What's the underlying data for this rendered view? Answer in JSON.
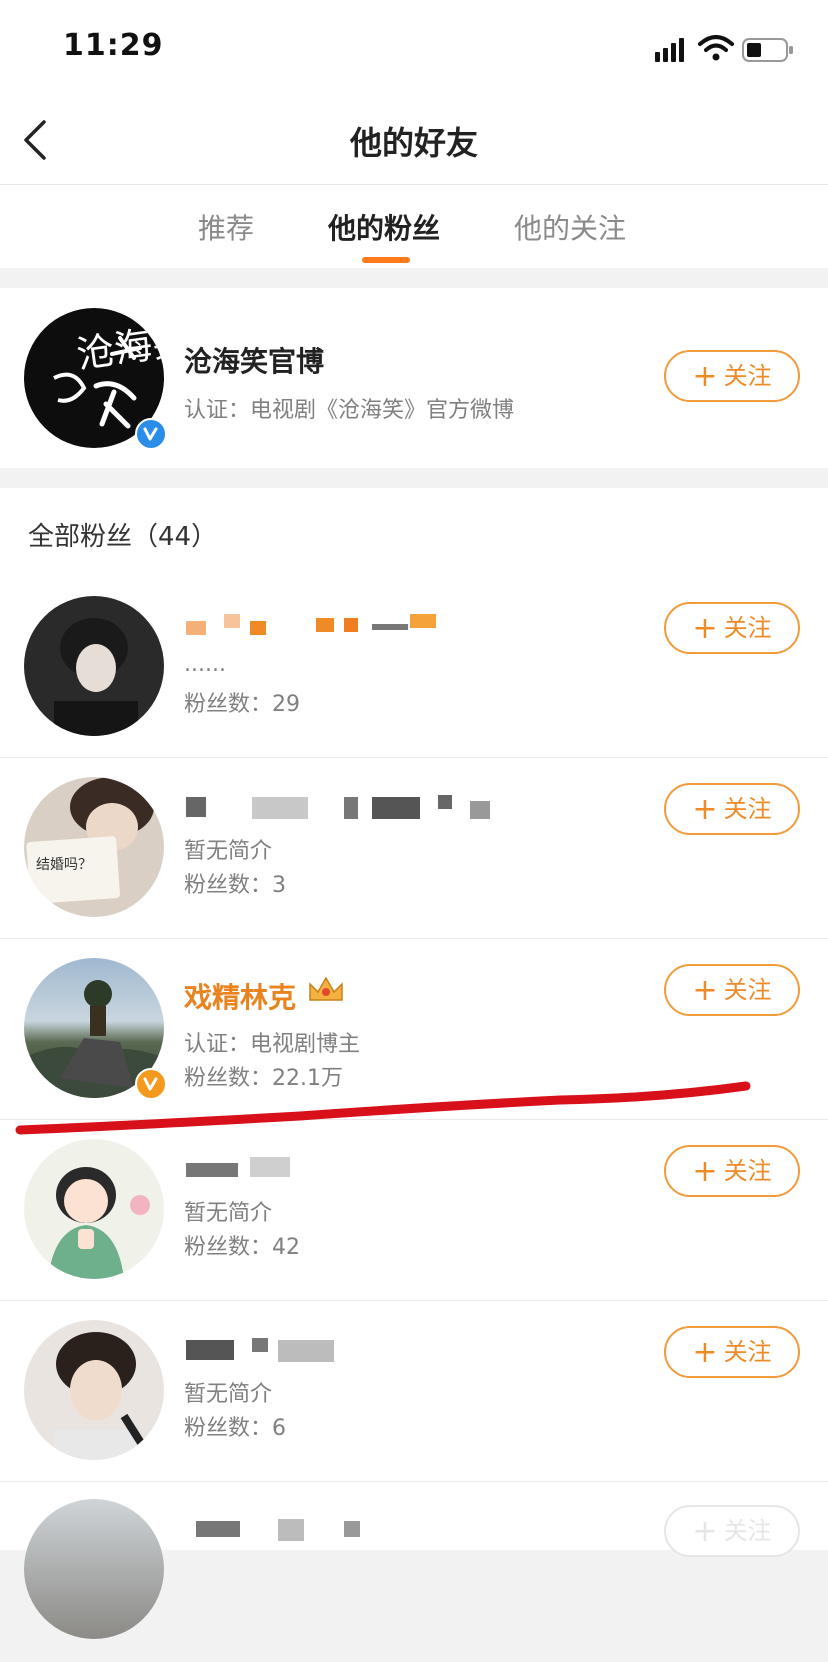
{
  "status": {
    "time": "11:29"
  },
  "nav": {
    "title": "他的好友"
  },
  "tabs": [
    {
      "label": "推荐"
    },
    {
      "label": "他的粉丝"
    },
    {
      "label": "他的关注"
    }
  ],
  "featured": {
    "name": "沧海笑官博",
    "desc": "认证：电视剧《沧海笑》官方微博",
    "follow": "关注",
    "logo_text": "沧海笑"
  },
  "section": {
    "title": "全部粉丝（44）"
  },
  "rows": [
    {
      "desc": "......",
      "fans": "粉丝数：29",
      "follow": "关注"
    },
    {
      "desc": "暂无简介",
      "fans": "粉丝数：3",
      "follow": "关注",
      "note_text": "结婚吗？"
    },
    {
      "name": "戏精林克",
      "desc": "认证：电视剧博主",
      "fans": "粉丝数：22.1万",
      "follow": "关注"
    },
    {
      "desc": "暂无简介",
      "fans": "粉丝数：42",
      "follow": "关注"
    },
    {
      "desc": "暂无简介",
      "fans": "粉丝数：6",
      "follow": "关注"
    },
    {
      "follow": "关注"
    }
  ],
  "colors": {
    "accent": "#ff7a1a",
    "follow_border": "#f29b3b",
    "verified_blue": "#2a8ee8",
    "verified_orange": "#f39a1e",
    "annotation_red": "#d8101a"
  }
}
